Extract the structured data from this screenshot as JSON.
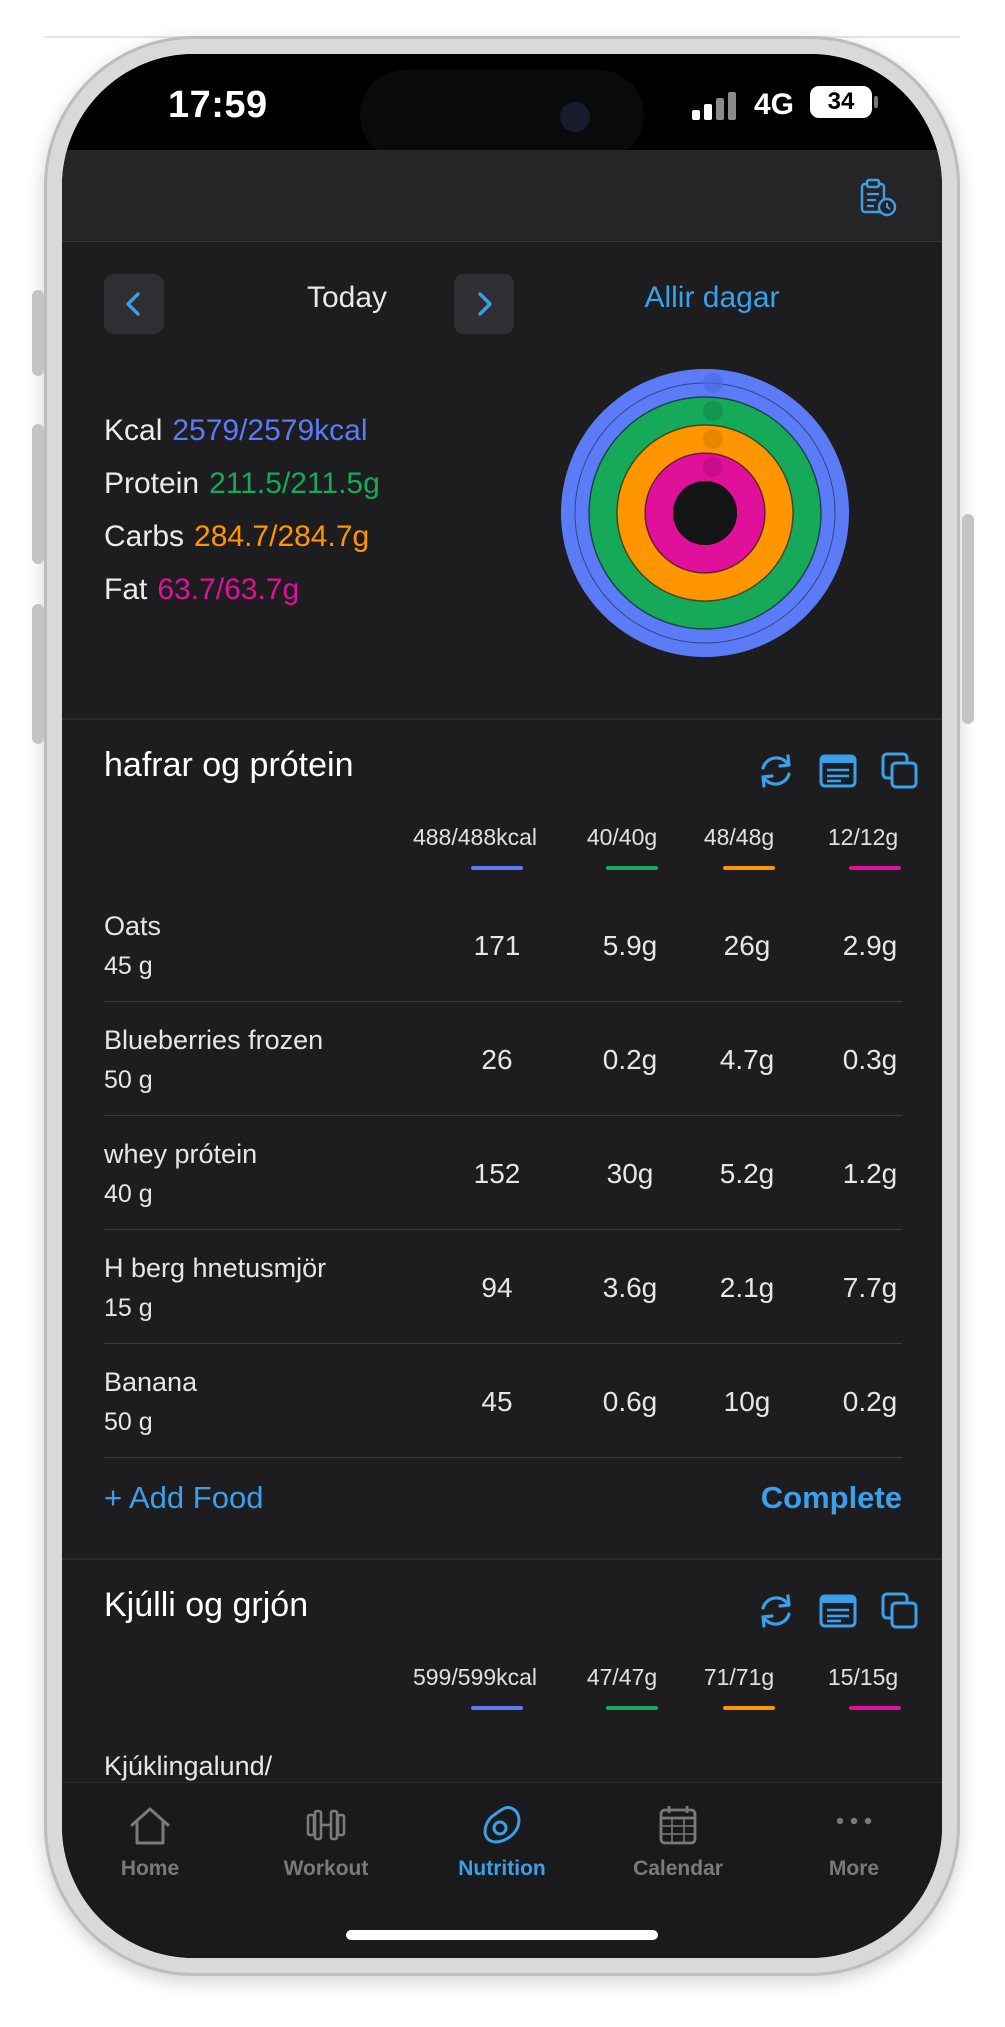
{
  "status": {
    "time": "17:59",
    "network": "4G",
    "battery": "34"
  },
  "colors": {
    "accent": "#3aa0ea",
    "kcal": "#5b7cf6",
    "protein": "#16a95a",
    "carbs": "#ff9500",
    "fat": "#e0109a"
  },
  "date_nav": {
    "prev_icon": "chevron-left-icon",
    "next_icon": "chevron-right-icon",
    "label": "Today",
    "all_days": "Allir dagar"
  },
  "summary": {
    "kcal": {
      "label": "Kcal",
      "value": "2579/2579kcal",
      "progress": 1.0
    },
    "protein": {
      "label": "Protein",
      "value": "211.5/211.5g",
      "progress": 1.0
    },
    "carbs": {
      "label": "Carbs",
      "value": "284.7/284.7g",
      "progress": 1.0
    },
    "fat": {
      "label": "Fat",
      "value": "63.7/63.7g",
      "progress": 1.0
    }
  },
  "meals": [
    {
      "title": "hafrar og prótein",
      "totals": {
        "kcal": "488/488kcal",
        "protein": "40/40g",
        "carbs": "48/48g",
        "fat": "12/12g"
      },
      "foods": [
        {
          "name": "Oats",
          "qty": "45 g",
          "kcal": "171",
          "protein": "5.9g",
          "carbs": "26g",
          "fat": "2.9g"
        },
        {
          "name": "Blueberries frozen",
          "qty": "50 g",
          "kcal": "26",
          "protein": "0.2g",
          "carbs": "4.7g",
          "fat": "0.3g"
        },
        {
          "name": "whey prótein",
          "qty": "40 g",
          "kcal": "152",
          "protein": "30g",
          "carbs": "5.2g",
          "fat": "1.2g"
        },
        {
          "name": "H berg hnetusmjör",
          "qty": "15 g",
          "kcal": "94",
          "protein": "3.6g",
          "carbs": "2.1g",
          "fat": "7.7g"
        },
        {
          "name": "Banana",
          "qty": "50 g",
          "kcal": "45",
          "protein": "0.6g",
          "carbs": "10g",
          "fat": "0.2g"
        }
      ],
      "add_food": "+ Add Food",
      "complete": "Complete"
    },
    {
      "title": "Kjúlli og grjón",
      "totals": {
        "kcal": "599/599kcal",
        "protein": "47/47g",
        "carbs": "71/71g",
        "fat": "15/15g"
      },
      "foods": [
        {
          "name": "Kjúklingalund/"
        }
      ]
    }
  ],
  "tabs": [
    {
      "label": "Home",
      "icon": "home-icon"
    },
    {
      "label": "Workout",
      "icon": "dumbbell-icon"
    },
    {
      "label": "Nutrition",
      "icon": "avocado-icon",
      "active": true
    },
    {
      "label": "Calendar",
      "icon": "calendar-icon"
    },
    {
      "label": "More",
      "icon": "more-icon"
    }
  ]
}
